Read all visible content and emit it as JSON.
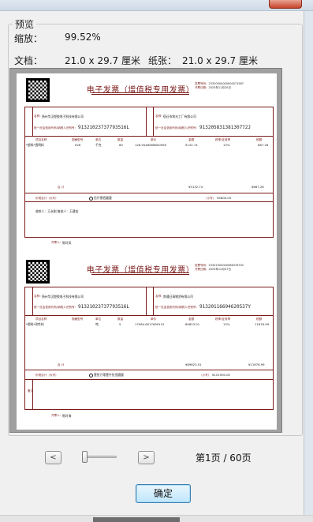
{
  "dialog": {
    "group_title": "预览",
    "zoom_label": "缩放：",
    "zoom_value": "99.52%",
    "doc_label": "文档：",
    "doc_value": "21.0 x 29.7 厘米",
    "paper_label": "纸张：",
    "paper_value": "21.0 x 29.7 厘米",
    "page_indicator": "第1页 / 60页",
    "prev_label": "<",
    "next_label": ">",
    "ok_label": "确定",
    "zoom_slider_fraction": 0.0
  },
  "invoices": [
    {
      "title": "电子发票（增值税专用发票）",
      "invoice_no_label": "发票号码：",
      "invoice_no": "23320000000000071567",
      "date_label": "开票日期：",
      "date": "2023年11月20日",
      "buyer_label": "名称：",
      "buyer_name": "扬州华汉塑胶电子科技有限公司",
      "buyer_tax_label": "统一社会信用代码/纳税人识别号：",
      "buyer_tax_id": "91321023737793516L",
      "seller_label": "名称：",
      "seller_name": "宿迁市和光工厂有限公司",
      "seller_tax_label": "统一社会信用代码/纳税人识别号：",
      "seller_tax_id": "91320583138130772J",
      "headers": [
        "项目名称",
        "规格型号",
        "单位",
        "数量",
        "单价",
        "金额",
        "税率/征收率",
        "税额"
      ],
      "row": [
        "*塑料*透明料",
        "K26",
        "千克",
        "60",
        "126.0548566800956",
        "5132.74",
        "13%",
        "667.26"
      ],
      "total_label": "合    计",
      "total_amount": "¥5132.74",
      "total_tax": "¥667.26",
      "grand_label": "价税合计（大写）",
      "grand_words": "伍仟捌佰圆整",
      "grand_small_label": "（小写）",
      "grand_small": "¥5800.00",
      "remark_text": "收款人：王永刚    复核人：王建宏",
      "issuer_label": "开票人：",
      "issuer": "陈玲凤"
    },
    {
      "title": "电子发票（增值税专用发票）",
      "invoice_no_label": "发票号码：",
      "invoice_no": "23322000000066376702",
      "date_label": "开票日期：",
      "date": "2023年12月07日",
      "buyer_label": "名称：",
      "buyer_name": "扬州华汉塑胶电子科技有限公司",
      "buyer_tax_label": "统一社会信用代码/纳税人识别号：",
      "buyer_tax_id": "91321023737793516L",
      "seller_label": "名称：",
      "seller_name": "南通日清物资有限公司",
      "seller_tax_label": "统一社会信用代码/纳税人识别号：",
      "seller_tax_id": "91320116694620537Y",
      "headers": [
        "项目名称",
        "规格型号",
        "单位",
        "数量",
        "单价",
        "金额",
        "税率/征收率",
        "税额"
      ],
      "row": [
        "*塑料*改性料",
        "",
        "吨",
        "5",
        "17964.6017699115",
        "89823.01",
        "13%",
        "11676.99"
      ],
      "total_label": "合    计",
      "total_amount": "¥89823.01",
      "total_tax": "¥11676.99",
      "grand_label": "价税合计（大写）",
      "grand_words": "壹拾万零壹仟伍佰圆整",
      "grand_small_label": "（小写）",
      "grand_small": "¥101500.00",
      "remark_label": "备注",
      "issuer_label": "开票人：",
      "issuer": "陈玲海"
    }
  ]
}
